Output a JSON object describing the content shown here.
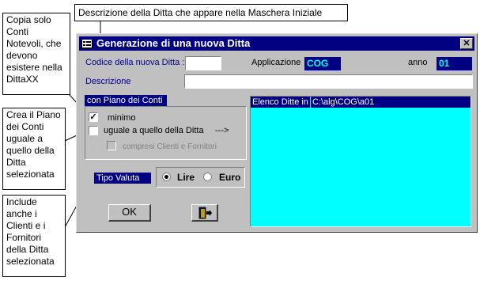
{
  "callouts": {
    "top": "Descrizione della Ditta che appare nella Maschera Iniziale",
    "left1": "Copia solo\nConti\nNotevoli, che\ndevono\nesistere nella\nDittaXX",
    "left2": "Crea il Piano\ndei Conti\nuguale a\nquello della\nDitta\nselezionata",
    "left3": "Include\nanche i\nClienti e i\nFornitori\ndella Ditta\nselezionata"
  },
  "window": {
    "title": "Generazione di una nuova Ditta",
    "close_glyph": "✕"
  },
  "form": {
    "codice_label": "Codice della nuova Ditta :",
    "codice_value": "",
    "applicazione_label": "Applicazione",
    "applicazione_value": "COG",
    "anno_label": "anno",
    "anno_value": "01",
    "descrizione_label": "Descrizione",
    "descrizione_value": ""
  },
  "piano": {
    "header": "con Piano dei Conti",
    "option_minimo": "minimo",
    "option_minimo_checked": true,
    "option_uguale": "uguale a quello della Ditta",
    "option_uguale_checked": false,
    "arrow": "--->",
    "option_clienti": "compresi Clienti e Fornitori",
    "option_clienti_checked": false
  },
  "valuta": {
    "label": "Tipo Valuta",
    "lire": "Lire",
    "euro": "Euro",
    "selected": "Lire"
  },
  "elenco": {
    "label": "Elenco Ditte in",
    "path": "C:\\alg\\COG\\a01"
  },
  "buttons": {
    "ok": "OK",
    "exit_icon": "exit-door-icon"
  },
  "colors": {
    "titlebar": "#000080",
    "list_bg": "#00ffff",
    "label_text": "#00008b"
  }
}
